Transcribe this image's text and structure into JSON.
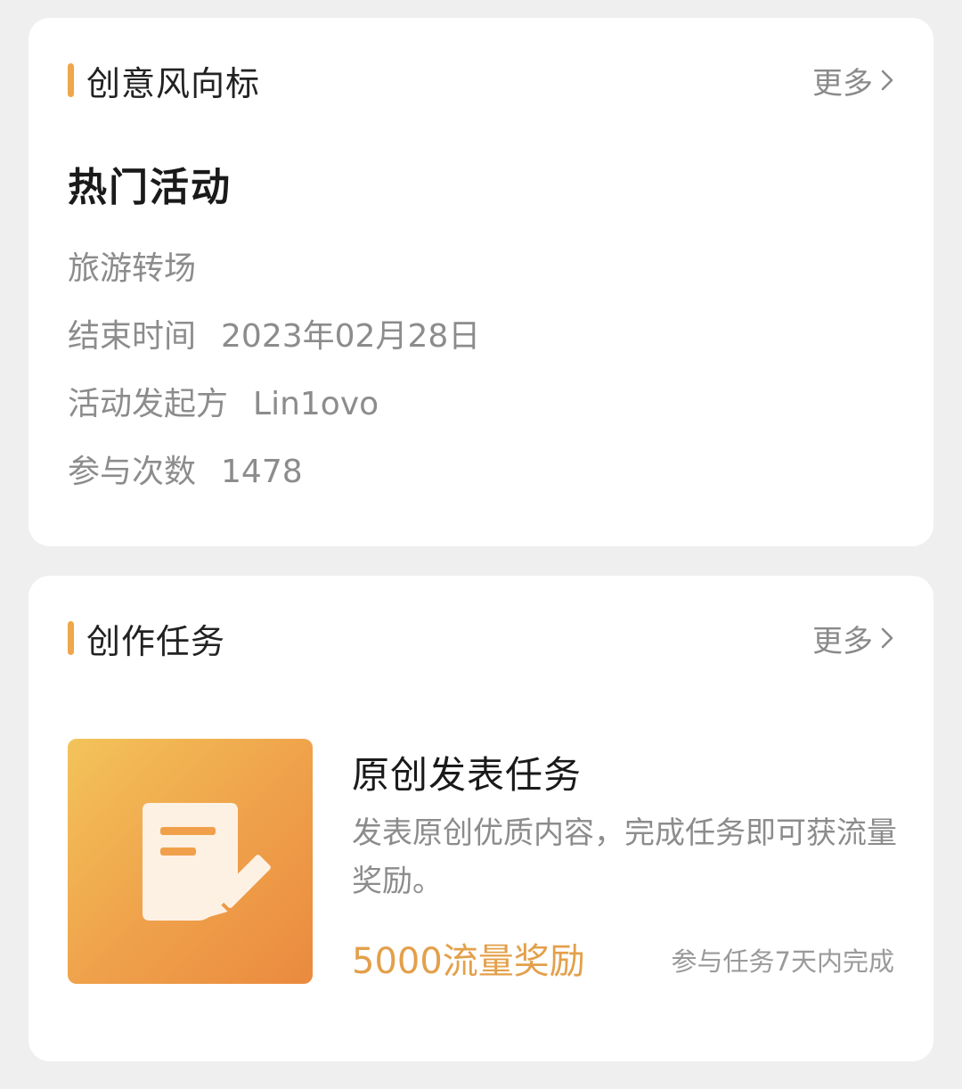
{
  "colors": {
    "accent": "#f0a64a",
    "background": "#efefef",
    "card": "#ffffff"
  },
  "trend_section": {
    "title": "创意风向标",
    "more_label": "更多",
    "more_icon": "chevron-right-icon",
    "hot_title": "热门活动",
    "activity_name": "旅游转场",
    "end_time_label": "结束时间",
    "end_time_value": "2023年02月28日",
    "sponsor_label": "活动发起方",
    "sponsor_value": "Lin1ovo",
    "participation_label": "参与次数",
    "participation_value": "1478"
  },
  "task_section": {
    "title": "创作任务",
    "more_label": "更多",
    "more_icon": "chevron-right-icon",
    "task": {
      "icon": "document-edit-icon",
      "title": "原创发表任务",
      "description": "发表原创优质内容，完成任务即可获流量奖励。",
      "reward": "5000流量奖励",
      "deadline": "参与任务7天内完成"
    }
  }
}
